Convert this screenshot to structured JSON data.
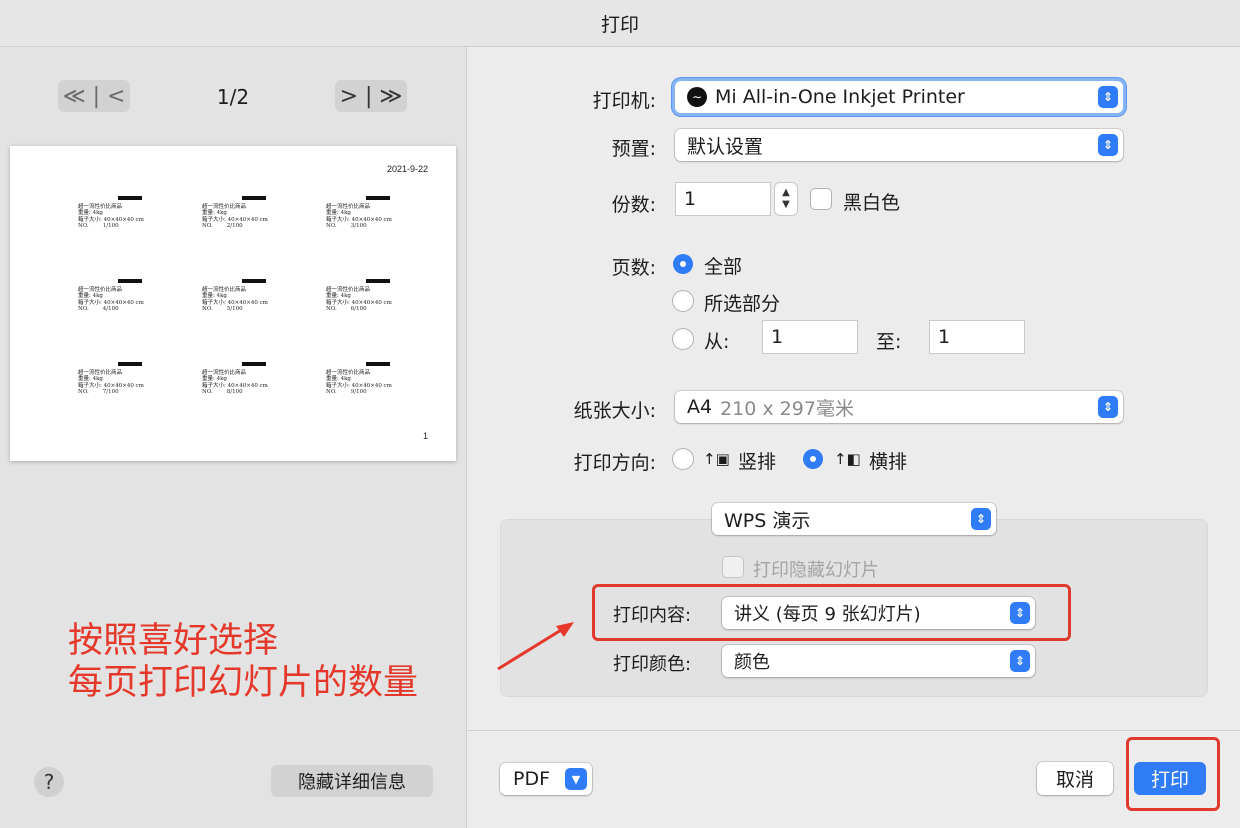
{
  "window": {
    "title": "打印"
  },
  "preview": {
    "first_prev": "≪ | <",
    "next_last": "> | ≫",
    "page_indicator": "1/2",
    "date": "2021-9-22",
    "page_number": "1",
    "slides": [
      {
        "line1": "超一流性价比商品",
        "line2": "重量: 4kg",
        "line3": "箱子大小: 40×40×40 cm",
        "no_label": "NO.",
        "no_value": "1/100"
      },
      {
        "line1": "超一流性价比商品",
        "line2": "重量: 4kg",
        "line3": "箱子大小: 40×40×40 cm",
        "no_label": "NO.",
        "no_value": "2/100"
      },
      {
        "line1": "超一流性价比商品",
        "line2": "重量: 4kg",
        "line3": "箱子大小: 40×40×40 cm",
        "no_label": "NO.",
        "no_value": "3/100"
      },
      {
        "line1": "超一流性价比商品",
        "line2": "重量: 4kg",
        "line3": "箱子大小: 40×40×40 cm",
        "no_label": "NO.",
        "no_value": "4/100"
      },
      {
        "line1": "超一流性价比商品",
        "line2": "重量: 4kg",
        "line3": "箱子大小: 40×40×40 cm",
        "no_label": "NO.",
        "no_value": "5/100"
      },
      {
        "line1": "超一流性价比商品",
        "line2": "重量: 4kg",
        "line3": "箱子大小: 40×40×40 cm",
        "no_label": "NO.",
        "no_value": "6/100"
      },
      {
        "line1": "超一流性价比商品",
        "line2": "重量: 4kg",
        "line3": "箱子大小: 40×40×40 cm",
        "no_label": "NO.",
        "no_value": "7/100"
      },
      {
        "line1": "超一流性价比商品",
        "line2": "重量: 4kg",
        "line3": "箱子大小: 40×40×40 cm",
        "no_label": "NO.",
        "no_value": "8/100"
      },
      {
        "line1": "超一流性价比商品",
        "line2": "重量: 4kg",
        "line3": "箱子大小: 40×40×40 cm",
        "no_label": "NO.",
        "no_value": "9/100"
      }
    ]
  },
  "left_footer": {
    "help": "?",
    "hide_details": "隐藏详细信息"
  },
  "settings": {
    "printer_label": "打印机:",
    "printer_value": "Mi All-in-One Inkjet Printer",
    "preset_label": "预置:",
    "preset_value": "默认设置",
    "copies_label": "份数:",
    "copies_value": "1",
    "bw_label": "黑白色",
    "pages_label": "页数:",
    "pages_all": "全部",
    "pages_selection": "所选部分",
    "pages_from": "从:",
    "pages_from_value": "1",
    "pages_to": "至:",
    "pages_to_value": "1",
    "paper_label": "纸张大小:",
    "paper_value": "A4",
    "paper_dims": "210 x 297毫米",
    "orientation_label": "打印方向:",
    "orientation_portrait": "竖排",
    "orientation_landscape": "横排"
  },
  "wps_panel": {
    "section": "WPS 演示",
    "hidden_slides": "打印隐藏幻灯片",
    "content_label": "打印内容:",
    "content_value": "讲义 (每页 9 张幻灯片)",
    "color_label": "打印颜色:",
    "color_value": "颜色"
  },
  "footer": {
    "pdf": "PDF",
    "cancel": "取消",
    "print": "打印"
  },
  "annotation": {
    "line1": "按照喜好选择",
    "line2": "每页打印幻灯片的数量"
  },
  "colors": {
    "accent": "#2f7cf6",
    "annotation": "#e5382a"
  }
}
